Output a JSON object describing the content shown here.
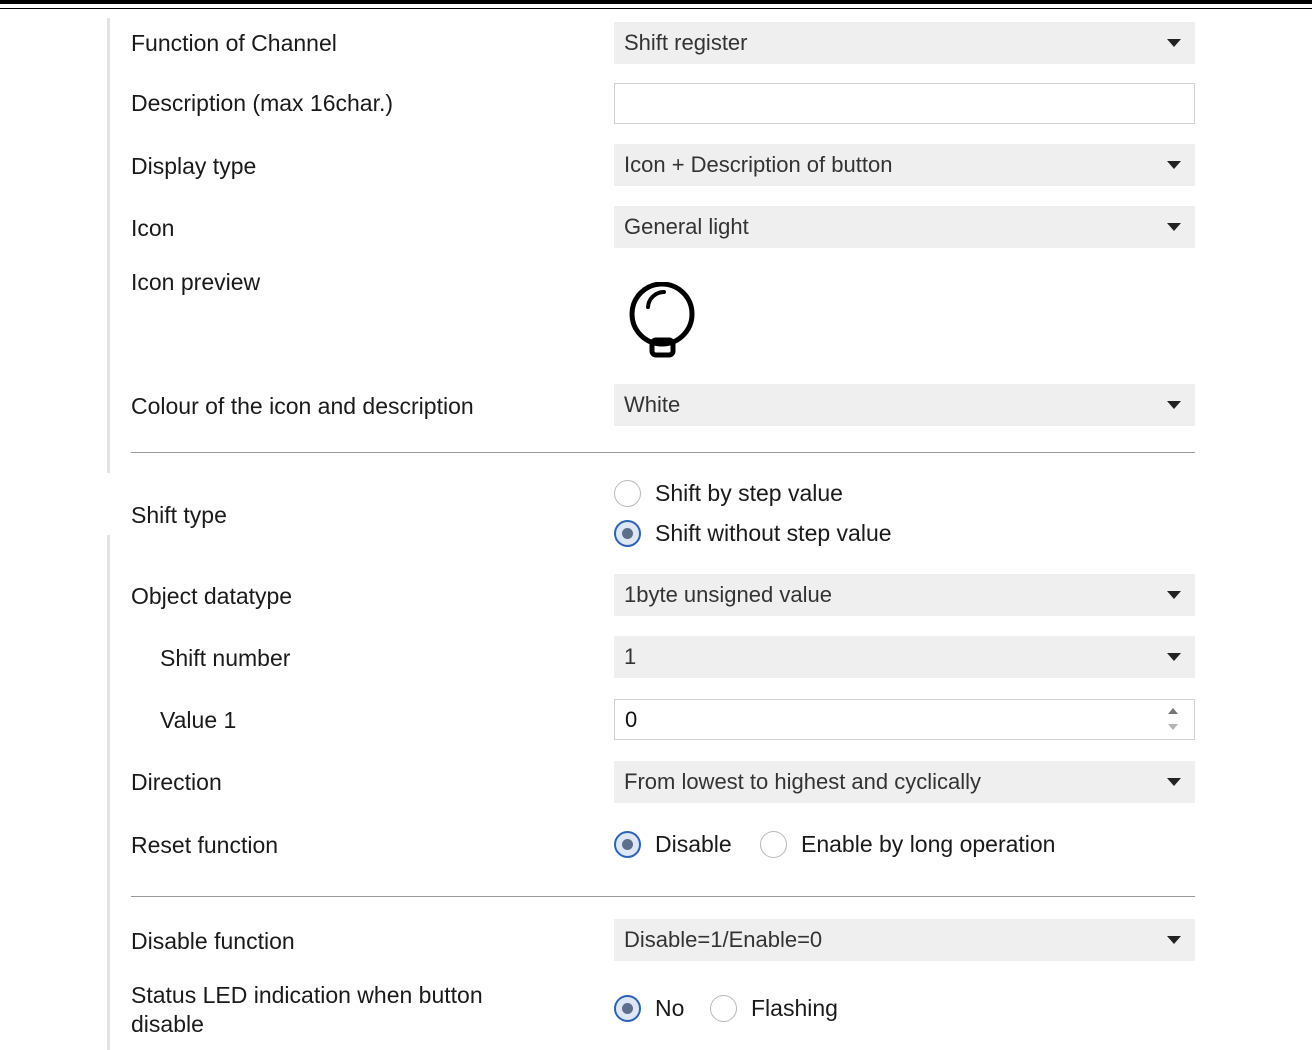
{
  "fields": {
    "function_of_channel": {
      "label": "Function of Channel",
      "value": "Shift register"
    },
    "description": {
      "label": "Description (max 16char.)",
      "value": ""
    },
    "display_type": {
      "label": "Display type",
      "value": "Icon + Description of button"
    },
    "icon": {
      "label": "Icon",
      "value": "General light"
    },
    "icon_preview": {
      "label": "Icon preview",
      "icon": "lightbulb-icon"
    },
    "colour": {
      "label": "Colour of the icon and description",
      "value": "White"
    },
    "shift_type": {
      "label": "Shift type",
      "options": [
        "Shift by step value",
        "Shift without step value"
      ],
      "selected": "Shift without step value"
    },
    "object_datatype": {
      "label": "Object datatype",
      "value": "1byte unsigned value"
    },
    "shift_number": {
      "label": "Shift number",
      "value": "1"
    },
    "value_1": {
      "label": "Value 1",
      "value": "0"
    },
    "direction": {
      "label": "Direction",
      "value": "From lowest to highest and cyclically"
    },
    "reset_function": {
      "label": "Reset function",
      "options": [
        "Disable",
        "Enable by long operation"
      ],
      "selected": "Disable"
    },
    "disable_function": {
      "label": "Disable function",
      "value": "Disable=1/Enable=0"
    },
    "status_led": {
      "label": " Status LED indication when button disable",
      "options": [
        "No",
        "Flashing"
      ],
      "selected": "No"
    }
  },
  "colors": {
    "dropdown_bg": "#efefef",
    "radio_checked": "#2b62b8",
    "divider": "#999999"
  }
}
